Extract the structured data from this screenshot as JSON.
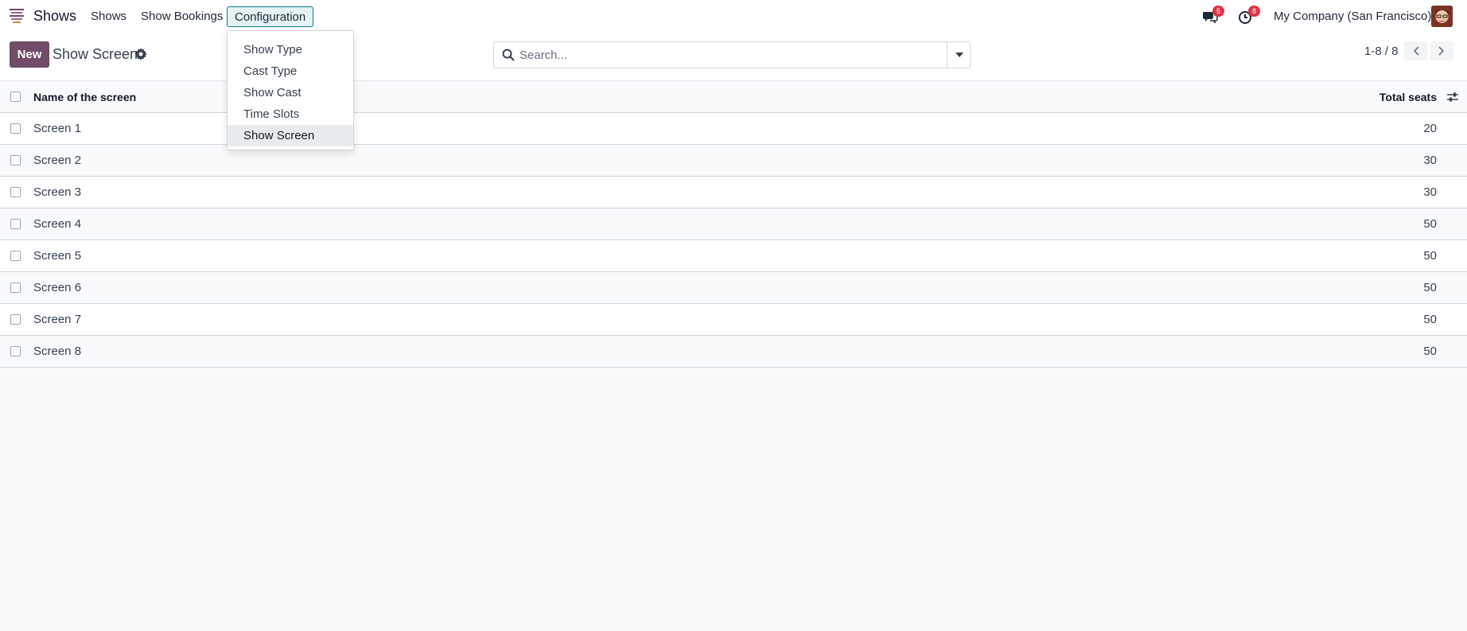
{
  "navbar": {
    "app_name": "Shows",
    "menu": [
      "Shows",
      "Show Bookings"
    ],
    "config_label": "Configuration",
    "messages_badge": "5",
    "activities_badge": "8",
    "company": "My Company (San Francisco)"
  },
  "dropdown": {
    "items": [
      "Show Type",
      "Cast Type",
      "Show Cast",
      "Time Slots",
      "Show Screen"
    ],
    "active": "Show Screen"
  },
  "control": {
    "new_label": "New",
    "title": "Show Screen",
    "search_placeholder": "Search...",
    "pager": "1-8 / 8"
  },
  "table": {
    "headers": {
      "name": "Name of the screen",
      "seats": "Total seats"
    },
    "rows": [
      {
        "name": "Screen 1",
        "seats": "20"
      },
      {
        "name": "Screen 2",
        "seats": "30"
      },
      {
        "name": "Screen 3",
        "seats": "30"
      },
      {
        "name": "Screen 4",
        "seats": "50"
      },
      {
        "name": "Screen 5",
        "seats": "50"
      },
      {
        "name": "Screen 6",
        "seats": "50"
      },
      {
        "name": "Screen 7",
        "seats": "50"
      },
      {
        "name": "Screen 8",
        "seats": "50"
      }
    ]
  },
  "colors": {
    "primary": "#714b67",
    "accent": "#017e84",
    "badge": "#dc3545"
  }
}
